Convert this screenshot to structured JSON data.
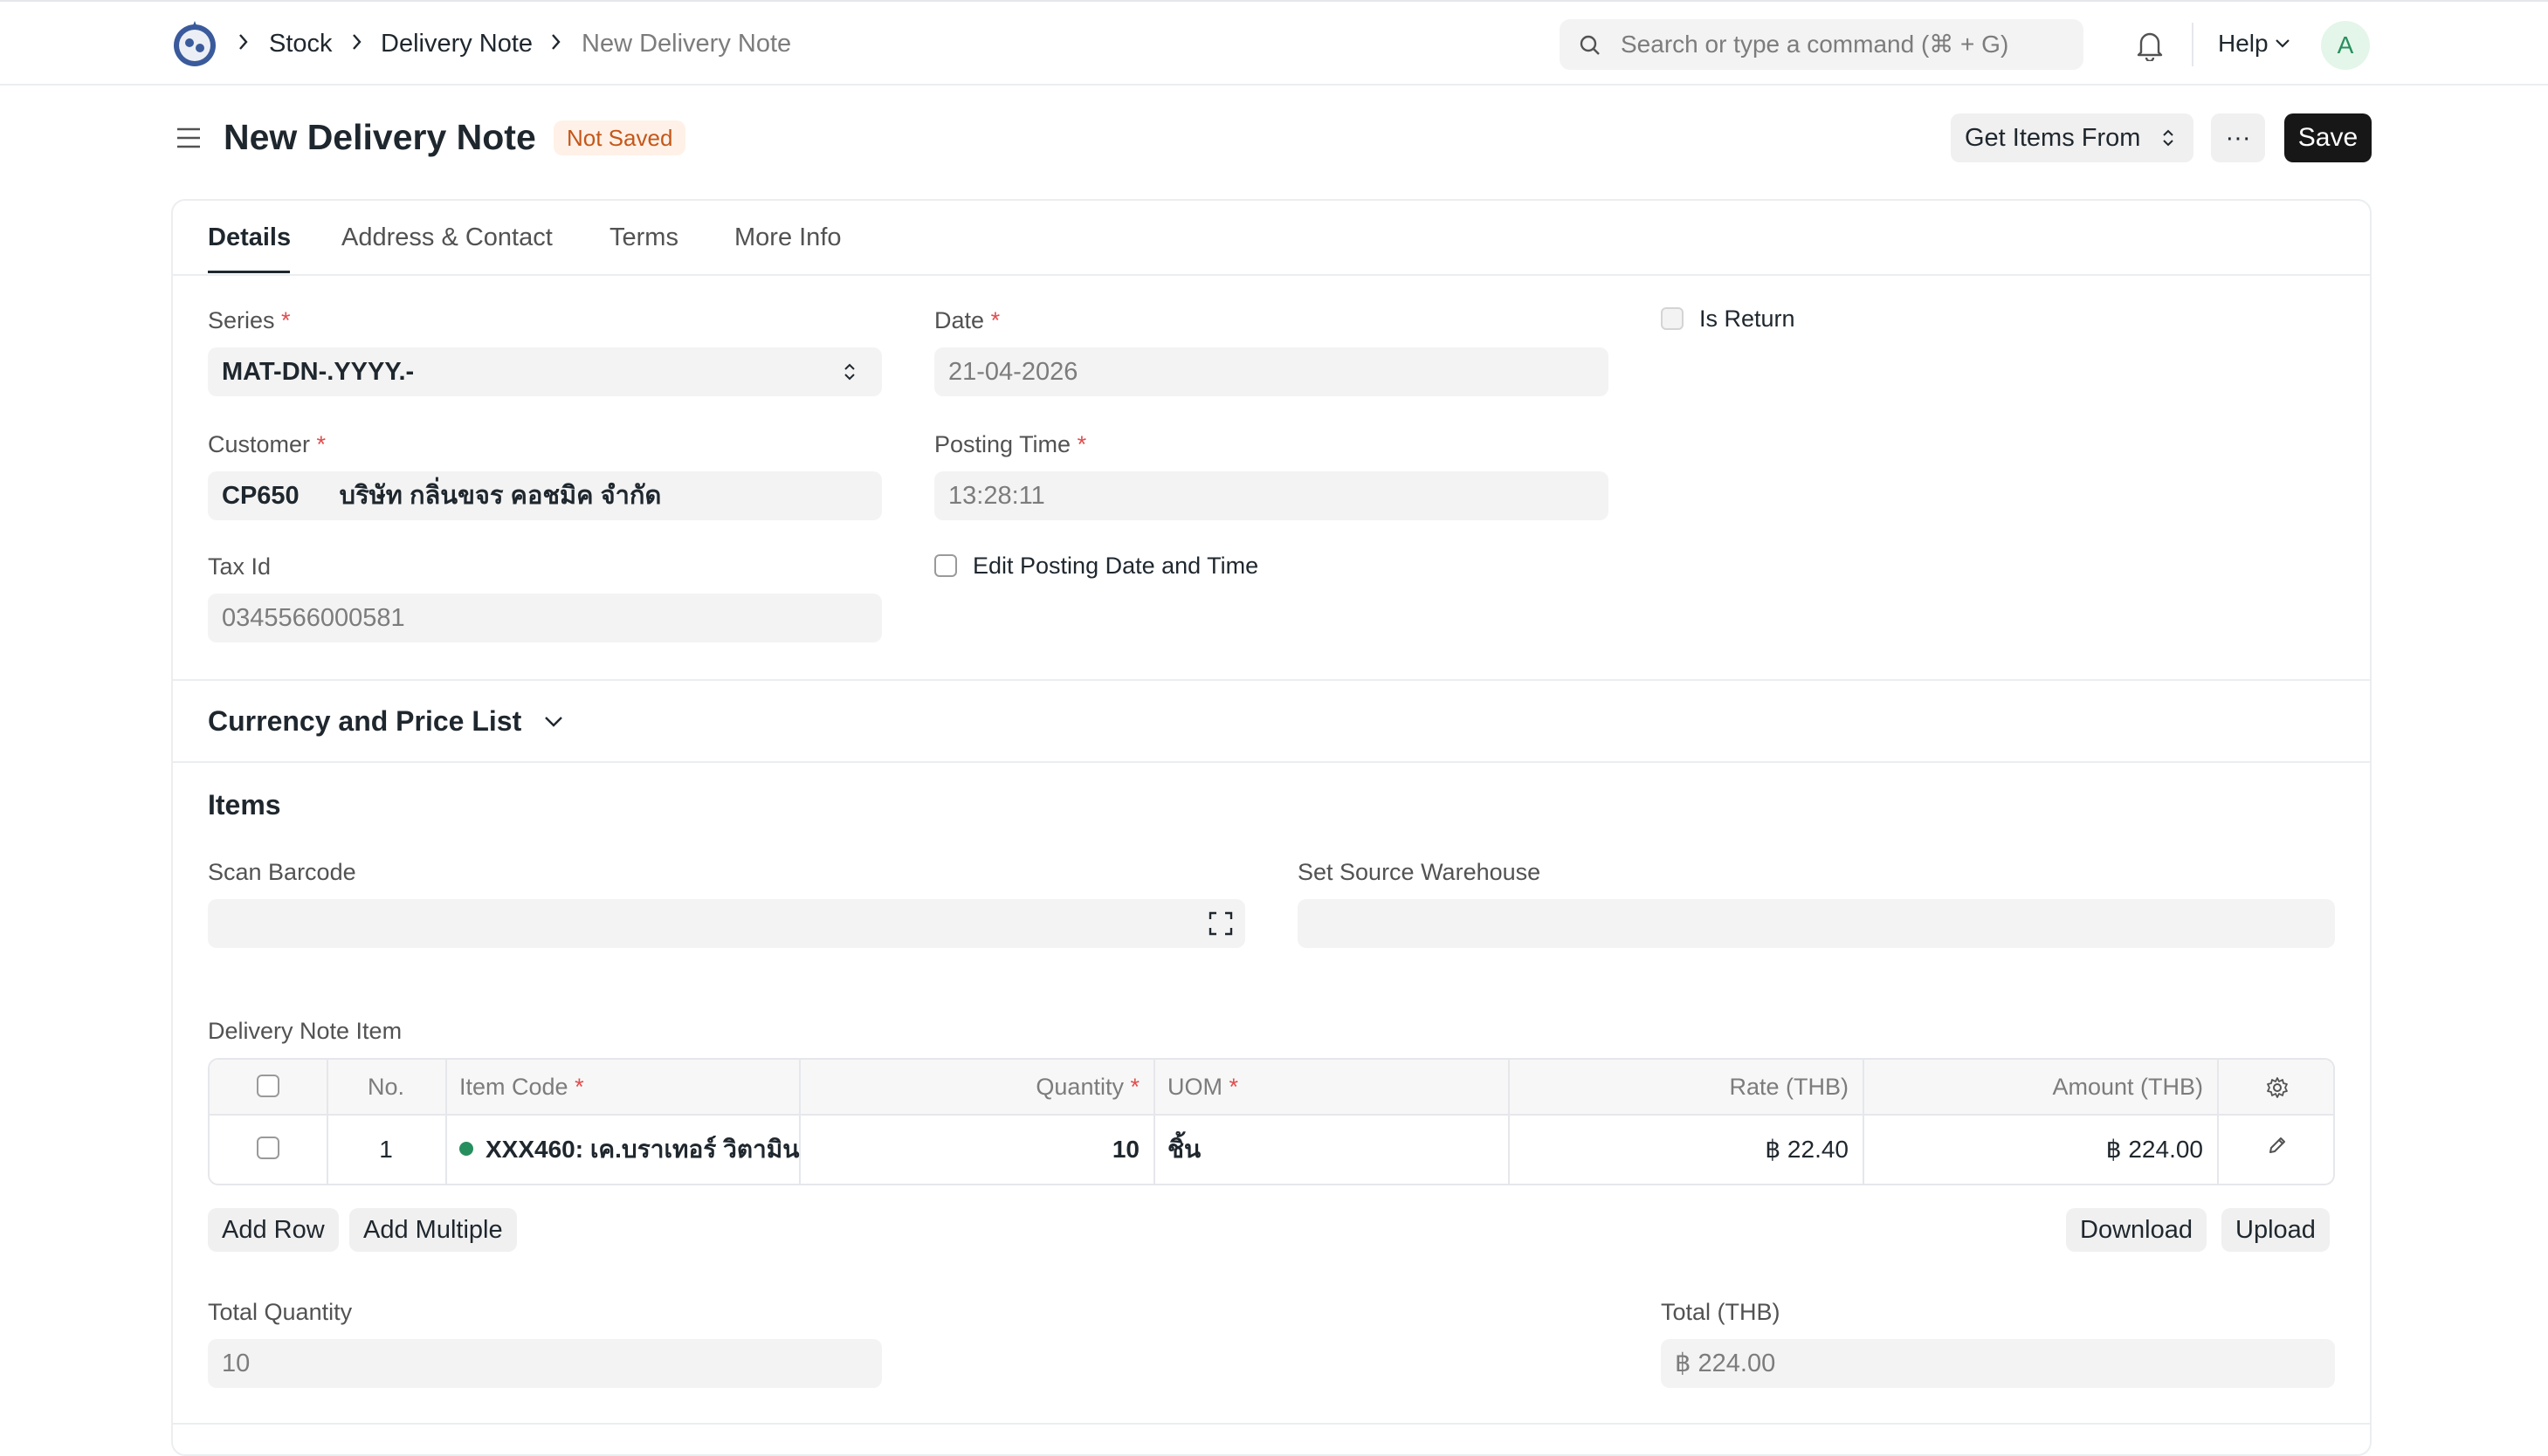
{
  "navbar": {
    "breadcrumbs": [
      "Stock",
      "Delivery Note",
      "New Delivery Note"
    ],
    "search_placeholder": "Search or type a command (⌘ + G)",
    "help_label": "Help",
    "avatar_initial": "A"
  },
  "page": {
    "title": "New Delivery Note",
    "status_badge": "Not Saved",
    "get_items_label": "Get Items From",
    "more_label": "···",
    "save_label": "Save"
  },
  "tabs": [
    "Details",
    "Address & Contact",
    "Terms",
    "More Info"
  ],
  "details": {
    "series_label": "Series",
    "series_value": "MAT-DN-.YYYY.-",
    "date_label": "Date",
    "date_value": "21-04-2026",
    "is_return_label": "Is Return",
    "customer_label": "Customer",
    "customer_code": "CP650",
    "customer_name": "บริษัท กลิ่นขจร คอชมิค จำกัด",
    "posting_time_label": "Posting Time",
    "posting_time_value": "13:28:11",
    "tax_id_label": "Tax Id",
    "tax_id_value": "0345566000581",
    "edit_posting_label": "Edit Posting Date and Time",
    "required_mark": "*"
  },
  "currency_section": {
    "title": "Currency and Price List"
  },
  "items_section": {
    "title": "Items",
    "scan_barcode_label": "Scan Barcode",
    "source_warehouse_label": "Set Source Warehouse",
    "table_label": "Delivery Note Item",
    "columns": {
      "no": "No.",
      "item_code": "Item Code",
      "quantity": "Quantity",
      "uom": "UOM",
      "rate": "Rate (THB)",
      "amount": "Amount (THB)"
    },
    "rows": [
      {
        "no": "1",
        "item_code": "XXX460: เค.บราเทอร์ วิตามิน",
        "quantity": "10",
        "uom": "ชิ้น",
        "rate": "฿ 22.40",
        "amount": "฿ 224.00"
      }
    ],
    "add_row_label": "Add Row",
    "add_multiple_label": "Add Multiple",
    "download_label": "Download",
    "upload_label": "Upload",
    "total_qty_label": "Total Quantity",
    "total_qty_value": "10",
    "total_label": "Total (THB)",
    "total_value": "฿ 224.00"
  }
}
